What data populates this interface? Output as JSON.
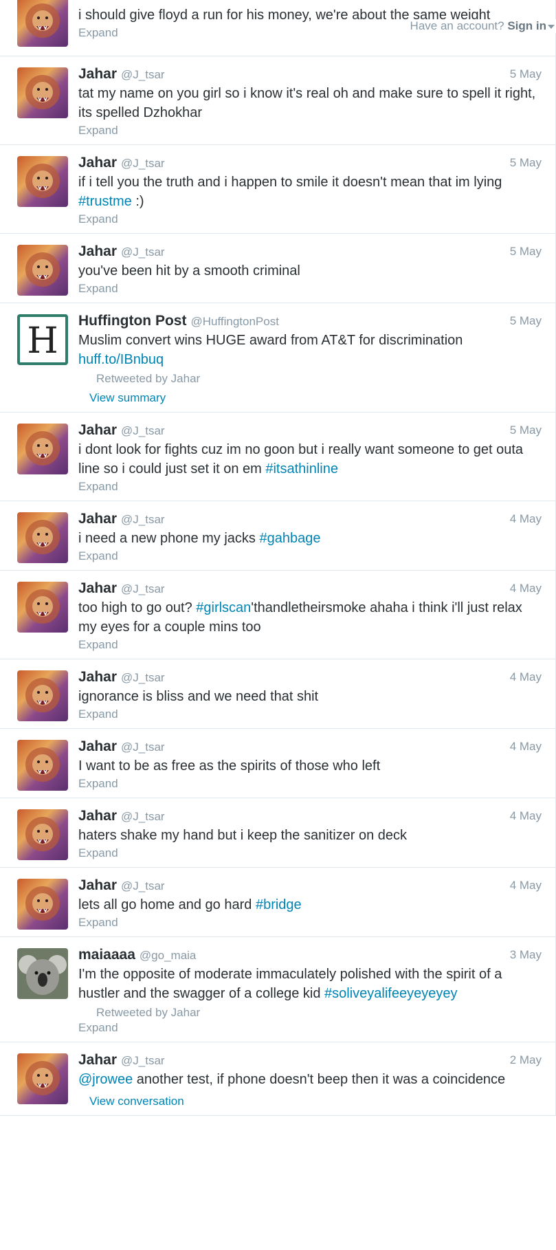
{
  "topbar": {
    "have_account": "Have an account?",
    "sign_in": "Sign in"
  },
  "labels": {
    "expand": "Expand",
    "view_summary": "View summary",
    "view_conversation": "View conversation"
  },
  "colors": {
    "link": "#0084b4",
    "muted": "#8899a6",
    "border": "#e1e8ed"
  },
  "tweets": [
    {
      "name": "",
      "handle": "",
      "time": "",
      "avatar": "lion",
      "text": "i should give floyd a run for his money, we're about the same weight",
      "footer": "expand"
    },
    {
      "name": "Jahar",
      "handle": "@J_tsar",
      "time": "5 May",
      "avatar": "lion",
      "text": "tat my name on you girl so i know it's real oh and make sure to spell it right, its spelled Dzhokhar",
      "footer": "expand"
    },
    {
      "name": "Jahar",
      "handle": "@J_tsar",
      "time": "5 May",
      "avatar": "lion",
      "text_pre": "if i tell you the truth and i happen to smile it doesn't mean that im lying ",
      "tag": "#trustme",
      "text_post": " :)",
      "footer": "expand"
    },
    {
      "name": "Jahar",
      "handle": "@J_tsar",
      "time": "5 May",
      "avatar": "lion",
      "text": "you've been hit by a smooth criminal",
      "footer": "expand"
    },
    {
      "name": "Huffington Post",
      "handle": "@HuffingtonPost",
      "time": "5 May",
      "avatar": "huffpost",
      "text": "Muslim convert wins HUGE award from AT&T for discrimination",
      "link": "huff.to/IBnbuq",
      "retweeted_by": "Retweeted by Jahar",
      "footer": "summary"
    },
    {
      "name": "Jahar",
      "handle": "@J_tsar",
      "time": "5 May",
      "avatar": "lion",
      "text_pre": "i dont look for fights cuz im no goon but i really want someone to get outa line so i could just set it on em ",
      "tag": "#itsathinline",
      "text_post": "",
      "footer": "expand"
    },
    {
      "name": "Jahar",
      "handle": "@J_tsar",
      "time": "4 May",
      "avatar": "lion",
      "text_pre": "i need a new phone my jacks ",
      "tag": "#gahbage",
      "text_post": "",
      "footer": "expand"
    },
    {
      "name": "Jahar",
      "handle": "@J_tsar",
      "time": "4 May",
      "avatar": "lion",
      "text_pre": "too high to go out? ",
      "tag": "#girlscan",
      "text_post": "'thandletheirsmoke ahaha i think i'll just relax my eyes for a couple mins too",
      "footer": "expand"
    },
    {
      "name": "Jahar",
      "handle": "@J_tsar",
      "time": "4 May",
      "avatar": "lion",
      "text": "ignorance is bliss and we need that shit",
      "footer": "expand"
    },
    {
      "name": "Jahar",
      "handle": "@J_tsar",
      "time": "4 May",
      "avatar": "lion",
      "text": "I want to be as free as the spirits of those who left",
      "footer": "expand"
    },
    {
      "name": "Jahar",
      "handle": "@J_tsar",
      "time": "4 May",
      "avatar": "lion",
      "text": "haters shake my hand but i keep the sanitizer on deck",
      "footer": "expand"
    },
    {
      "name": "Jahar",
      "handle": "@J_tsar",
      "time": "4 May",
      "avatar": "lion",
      "text_pre": "lets all go home and go hard ",
      "tag": "#bridge",
      "text_post": "",
      "footer": "expand"
    },
    {
      "name": "maiaaaa",
      "handle": "@go_maia",
      "time": "3 May",
      "avatar": "koala",
      "text_pre": "I'm the opposite of moderate immaculately polished with the spirit of a hustler and the swagger of a college kid ",
      "tag": "#soliveyalifeeyeyeyey",
      "text_post": "",
      "retweeted_by": "Retweeted by Jahar",
      "footer": "expand"
    },
    {
      "name": "Jahar",
      "handle": "@J_tsar",
      "time": "2 May",
      "avatar": "lion",
      "mention": "@jrowee",
      "text_post": " another test, if phone doesn't beep then it was a coincidence",
      "footer": "conversation"
    }
  ]
}
